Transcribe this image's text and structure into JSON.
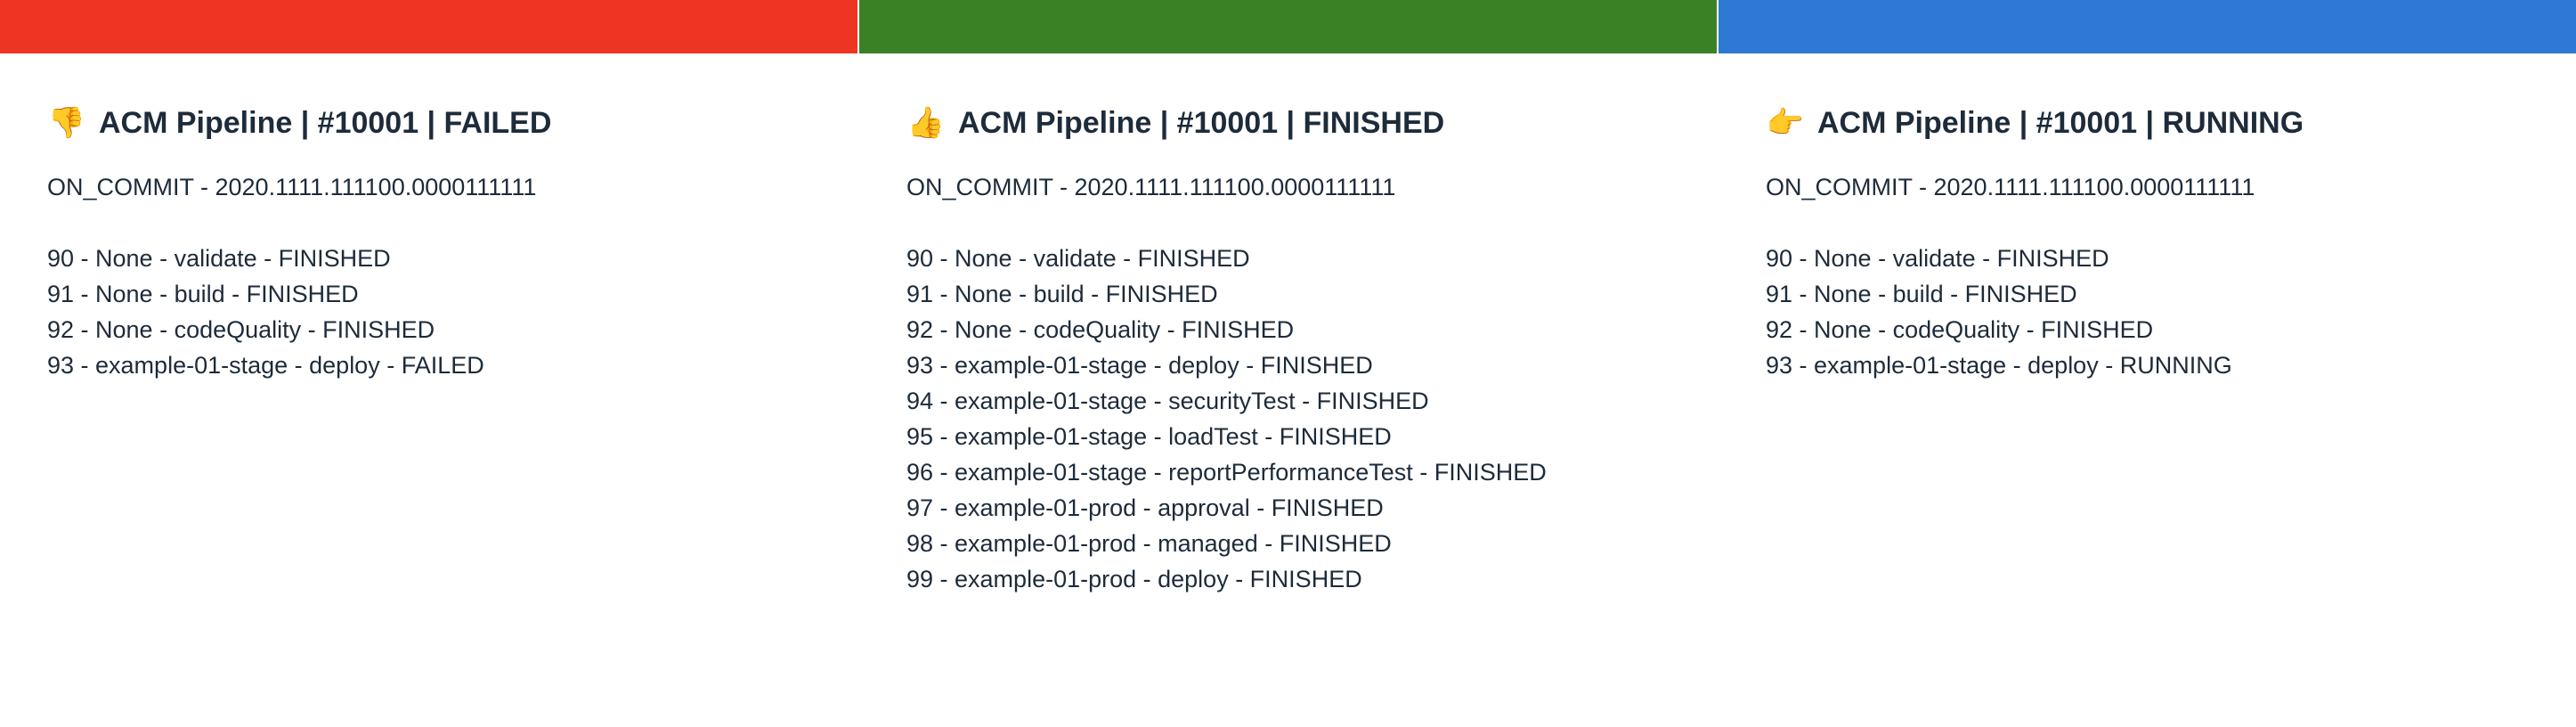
{
  "panels": [
    {
      "bar_color": "#ee3524",
      "emoji": "👎",
      "emoji_icon": "thumbs-down-icon",
      "title": "ACM Pipeline | #10001 | FAILED",
      "trigger": "ON_COMMIT - 2020.1111.111100.0000111111",
      "stages": [
        "90 - None - validate - FINISHED",
        "91 - None - build - FINISHED",
        "92 - None - codeQuality - FINISHED",
        "93 - example-01-stage - deploy - FAILED"
      ]
    },
    {
      "bar_color": "#3a8025",
      "emoji": "👍",
      "emoji_icon": "thumbs-up-icon",
      "title": "ACM Pipeline | #10001 | FINISHED",
      "trigger": "ON_COMMIT - 2020.1111.111100.0000111111",
      "stages": [
        "90 - None - validate - FINISHED",
        "91 - None - build - FINISHED",
        "92 - None - codeQuality - FINISHED",
        "93 - example-01-stage - deploy - FINISHED",
        "94 - example-01-stage - securityTest - FINISHED",
        "95 - example-01-stage - loadTest - FINISHED",
        "96 - example-01-stage - reportPerformanceTest - FINISHED",
        "97 - example-01-prod - approval - FINISHED",
        "98 - example-01-prod - managed - FINISHED",
        "99 - example-01-prod - deploy - FINISHED"
      ]
    },
    {
      "bar_color": "#2f78d3",
      "emoji": "👉",
      "emoji_icon": "pointing-right-icon",
      "title": "ACM Pipeline | #10001 | RUNNING",
      "trigger": "ON_COMMIT - 2020.1111.111100.0000111111",
      "stages": [
        "90 - None - validate - FINISHED",
        "91 - None - build - FINISHED",
        "92 - None - codeQuality - FINISHED",
        "93 - example-01-stage - deploy - RUNNING"
      ]
    }
  ]
}
